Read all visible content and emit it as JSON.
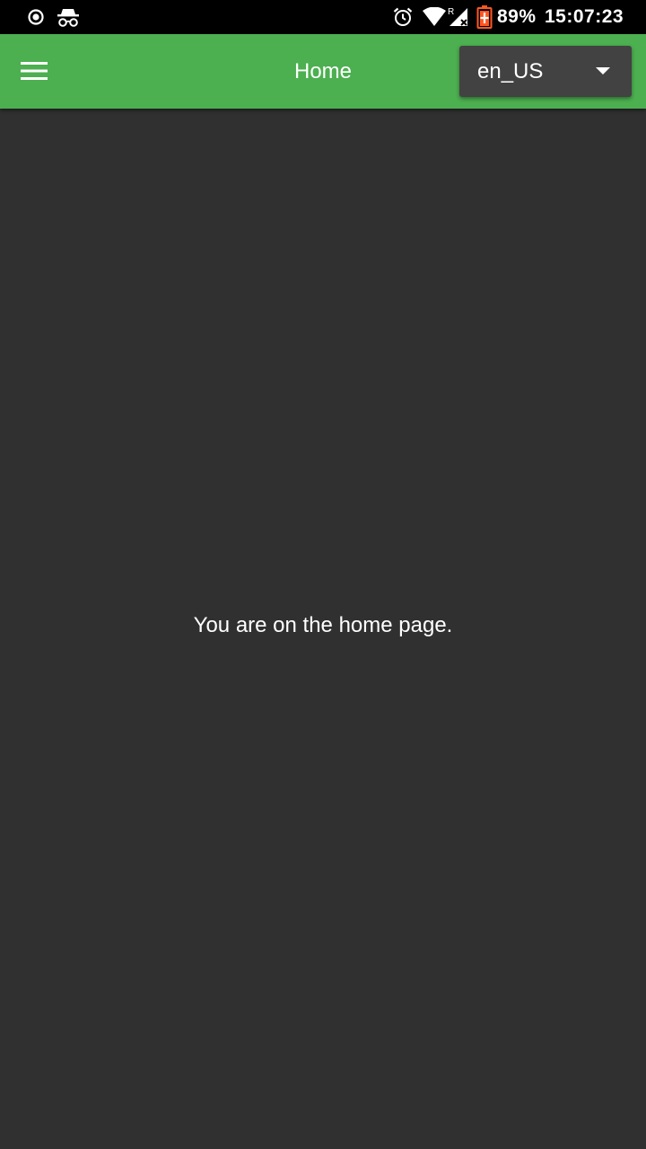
{
  "status_bar": {
    "left_icons": [
      "record-icon",
      "incognito-icon"
    ],
    "right_icons": [
      "alarm-icon",
      "wifi-icon",
      "signal-roaming-icon",
      "battery-charging-icon"
    ],
    "roaming_label": "R",
    "battery_percent": "89%",
    "time": "15:07:23"
  },
  "app_bar": {
    "title": "Home",
    "menu_icon": "hamburger-menu-icon",
    "background_color": "#4caf50",
    "locale_dropdown": {
      "selected": "en_US",
      "icon": "dropdown-arrow-icon"
    }
  },
  "content": {
    "message": "You are on the home page.",
    "background_color": "#303030"
  }
}
